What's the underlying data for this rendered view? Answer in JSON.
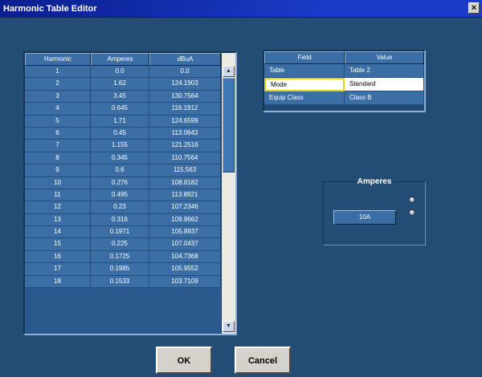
{
  "window": {
    "title": "Harmonic Table Editor",
    "close_glyph": "×"
  },
  "harmonic_table": {
    "columns": [
      "Harmonic",
      "Amperes",
      "dBuA"
    ],
    "rows": [
      [
        "1",
        "0.0",
        "0.0"
      ],
      [
        "2",
        "1.62",
        "124.1903"
      ],
      [
        "3",
        "3.45",
        "130.7564"
      ],
      [
        "4",
        "0.645",
        "116.1912"
      ],
      [
        "5",
        "1.71",
        "124.6599"
      ],
      [
        "6",
        "0.45",
        "113.0643"
      ],
      [
        "7",
        "1.155",
        "121.2516"
      ],
      [
        "8",
        "0.345",
        "110.7564"
      ],
      [
        "9",
        "0.6",
        "115.563"
      ],
      [
        "10",
        "0.276",
        "108.8182"
      ],
      [
        "11",
        "0.495",
        "113.8921"
      ],
      [
        "12",
        "0.23",
        "107.2346"
      ],
      [
        "13",
        "0.316",
        "109.8662"
      ],
      [
        "14",
        "0.1971",
        "105.8937"
      ],
      [
        "15",
        "0.225",
        "107.0437"
      ],
      [
        "16",
        "0.1725",
        "104.7368"
      ],
      [
        "17",
        "0.1985",
        "105.9552"
      ],
      [
        "18",
        "0.1533",
        "103.7109"
      ]
    ],
    "scroll_up_glyph": "▲",
    "scroll_down_glyph": "▼"
  },
  "field_table": {
    "columns": [
      "Field",
      "Value"
    ],
    "rows": [
      [
        "Table",
        "Table 2"
      ],
      [
        "Mode",
        "Standard"
      ],
      [
        "Equip Class",
        "Class B"
      ]
    ],
    "selected_row": 1
  },
  "amperes": {
    "label": "Amperes",
    "value": "10A"
  },
  "buttons": {
    "ok": "OK",
    "cancel": "Cancel"
  },
  "colors": {
    "background": "#244d76",
    "cell": "#3a6ea5",
    "selection_border": "#e7d21a"
  }
}
